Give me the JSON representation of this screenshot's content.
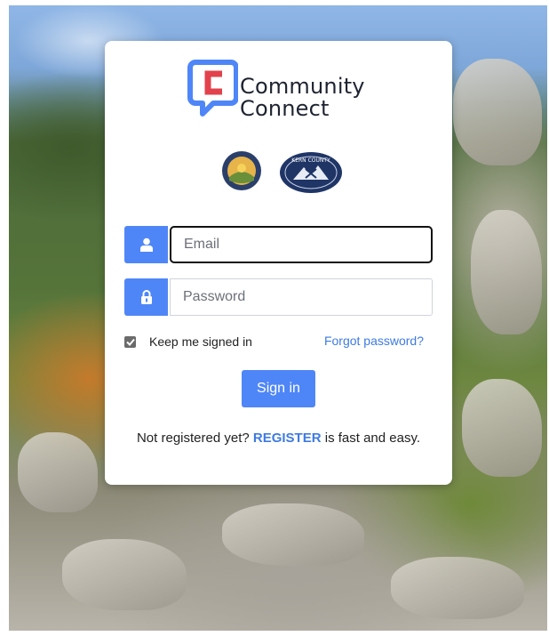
{
  "brand": {
    "line1": "Community",
    "line2": "Connect",
    "colors": {
      "logo_blue": "#4f86f7",
      "logo_red": "#e2424b"
    }
  },
  "seals": {
    "left": {
      "name": "eastern-kern-seal"
    },
    "right": {
      "name": "kern-county-seal",
      "text": "KERN COUNTY"
    }
  },
  "form": {
    "email": {
      "placeholder": "Email",
      "value": "",
      "icon": "user-icon"
    },
    "password": {
      "placeholder": "Password",
      "value": "",
      "icon": "lock-icon"
    },
    "remember": {
      "label": "Keep me signed in",
      "checked": true
    },
    "forgot_label": "Forgot password?",
    "submit_label": "Sign in"
  },
  "register": {
    "prefix": "Not registered yet?",
    "link_label": "REGISTER",
    "suffix": "is fast and easy."
  },
  "colors": {
    "accent": "#4f86f7",
    "link": "#3e7be0",
    "card_bg": "#ffffff"
  }
}
